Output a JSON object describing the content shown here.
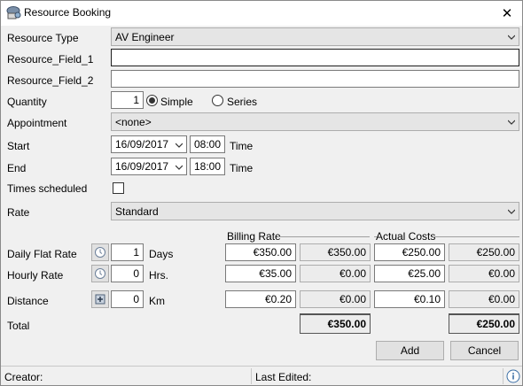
{
  "window": {
    "title": "Resource Booking",
    "close_glyph": "✕"
  },
  "labels": {
    "resource_type": "Resource Type",
    "field1": "Resource_Field_1",
    "field2": "Resource_Field_2",
    "quantity": "Quantity",
    "appointment": "Appointment",
    "start": "Start",
    "end": "End",
    "times_scheduled": "Times scheduled",
    "rate": "Rate",
    "daily_flat_rate": "Daily Flat Rate",
    "hourly_rate": "Hourly Rate",
    "distance": "Distance",
    "total": "Total",
    "time": "Time",
    "days": "Days",
    "hrs": "Hrs.",
    "km": "Km",
    "billing_rate": "Billing Rate",
    "actual_costs": "Actual Costs"
  },
  "fields": {
    "resource_type": "AV Engineer",
    "field1": "",
    "field2": "",
    "quantity": "1",
    "simple": "Simple",
    "series": "Series",
    "appointment": "<none>",
    "start_date": "16/09/2017",
    "start_time": "08:00",
    "end_date": "16/09/2017",
    "end_time": "18:00",
    "rate": "Standard"
  },
  "rates": {
    "daily": {
      "qty": "1",
      "billing": "€350.00",
      "billing_total": "€350.00",
      "actual": "€250.00",
      "actual_total": "€250.00"
    },
    "hourly": {
      "qty": "0",
      "billing": "€35.00",
      "billing_total": "€0.00",
      "actual": "€25.00",
      "actual_total": "€0.00"
    },
    "distance": {
      "qty": "0",
      "billing": "€0.20",
      "billing_total": "€0.00",
      "actual": "€0.10",
      "actual_total": "€0.00"
    },
    "total_billing": "€350.00",
    "total_actual": "€250.00"
  },
  "buttons": {
    "add": "Add",
    "cancel": "Cancel"
  },
  "status": {
    "creator": "Creator:",
    "last_edited": "Last Edited:"
  },
  "icons": [
    "resource-booking-icon",
    "close-icon",
    "chevron-down-icon",
    "clock-icon",
    "map-pin-icon",
    "info-icon"
  ]
}
